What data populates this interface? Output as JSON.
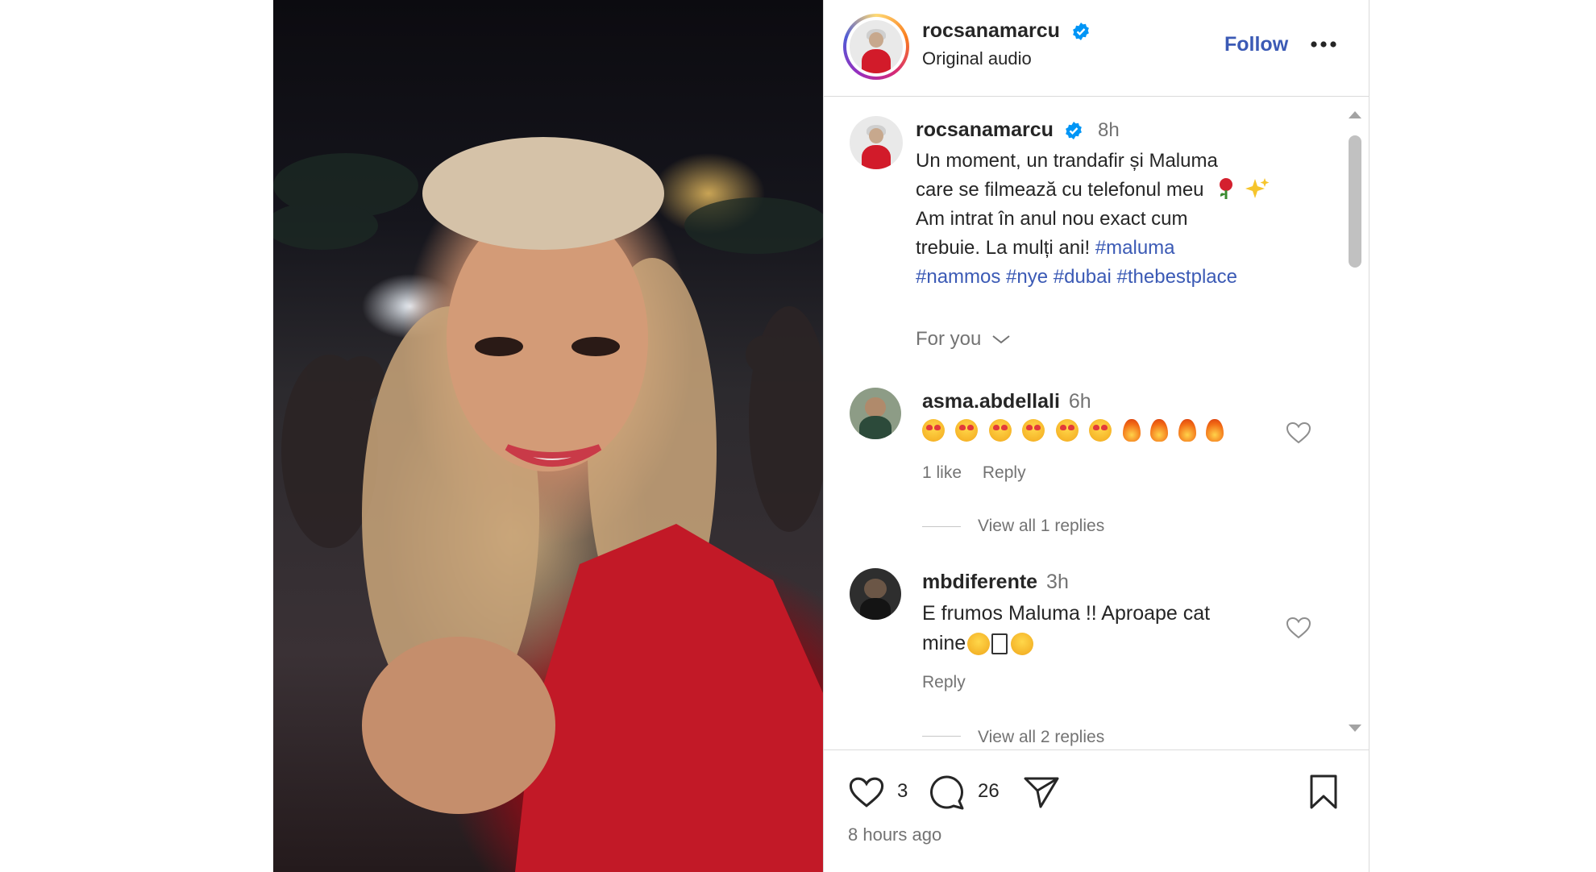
{
  "header": {
    "username": "rocsanamarcu",
    "subtitle": "Original audio",
    "follow_label": "Follow",
    "more_icon": "ellipsis-icon"
  },
  "post": {
    "username": "rocsanamarcu",
    "time": "8h",
    "caption_line1": "Un moment, un trandafir și Maluma",
    "caption_line2": "care se filmează cu telefonul meu",
    "caption_line3": "Am intrat în anul nou exact cum",
    "caption_line4": "trebuie. La mulți ani! ",
    "tags": [
      "#maluma",
      "#nammos",
      "#nye",
      "#dubai",
      "#thebestplace"
    ],
    "for_you_label": "For you"
  },
  "comments": [
    {
      "username": "asma.abdellali",
      "time": "6h",
      "likes_text": "1 like",
      "reply_label": "Reply",
      "view_replies": "View all 1 replies"
    },
    {
      "username": "mbdiferente",
      "time": "3h",
      "text_line1": "E frumos Maluma !! Aproape cat",
      "text_line2": "mine",
      "reply_label": "Reply",
      "view_replies": "View all 2 replies"
    }
  ],
  "actions": {
    "like_count": "3",
    "comment_count": "26",
    "timestamp": "8 hours ago"
  },
  "colors": {
    "accent": "#0095f6",
    "follow_text": "#3b5ab5",
    "hashtag": "#3b5ab5",
    "muted": "#737373"
  }
}
